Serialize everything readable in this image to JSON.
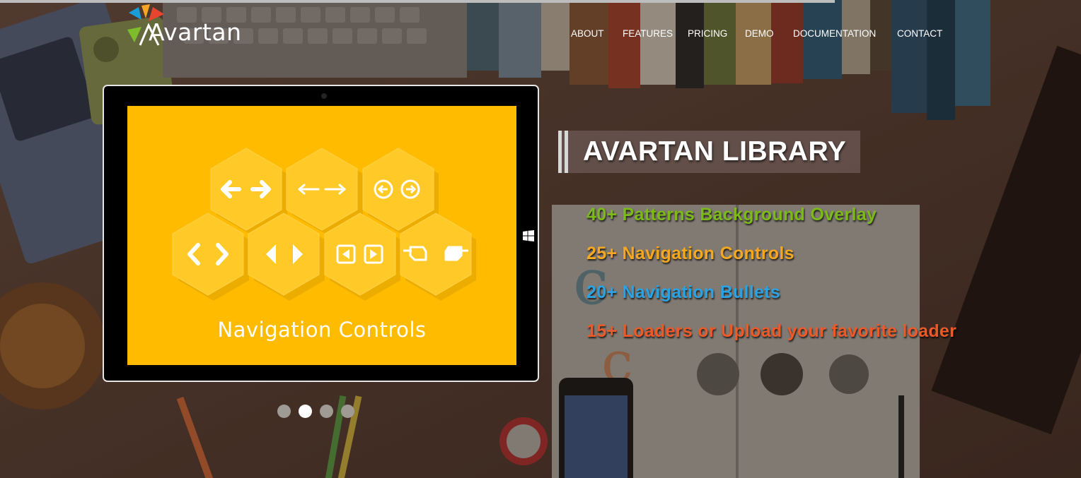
{
  "brand": {
    "name": "Avartan",
    "logo_colors": [
      "#1b9dd9",
      "#f6a623",
      "#e8452f",
      "#7dbd2b"
    ]
  },
  "nav": {
    "items": [
      {
        "label": "ABOUT",
        "name": "nav-about"
      },
      {
        "label": "FEATURES",
        "name": "nav-features"
      },
      {
        "label": "PRICING",
        "name": "nav-pricing"
      },
      {
        "label": "DEMO",
        "name": "nav-demo"
      },
      {
        "label": "DOCUMENTATION",
        "name": "nav-documentation"
      },
      {
        "label": "CONTACT",
        "name": "nav-contact"
      }
    ]
  },
  "slide": {
    "caption": "Navigation Controls",
    "screen_color": "#ffbb00",
    "icons": [
      "double-arrow-icon",
      "long-arrow-icon",
      "circle-arrow-icon",
      "chevron-icon",
      "triangle-arrow-icon",
      "square-arrow-icon",
      "pointing-hand-icon"
    ]
  },
  "slider": {
    "bullet_count": 4,
    "active_index": 1
  },
  "hero": {
    "title": "AVARTAN LIBRARY",
    "features": [
      {
        "text": "40+ Patterns Background Overlay",
        "color": "#7cba1a"
      },
      {
        "text": "25+ Navigation Controls",
        "color": "#f5a81f"
      },
      {
        "text": "20+ Navigation Bullets",
        "color": "#2ba3e3"
      },
      {
        "text": "15+ Loaders or Upload your favorite loader",
        "color": "#ed5a2a"
      }
    ]
  }
}
